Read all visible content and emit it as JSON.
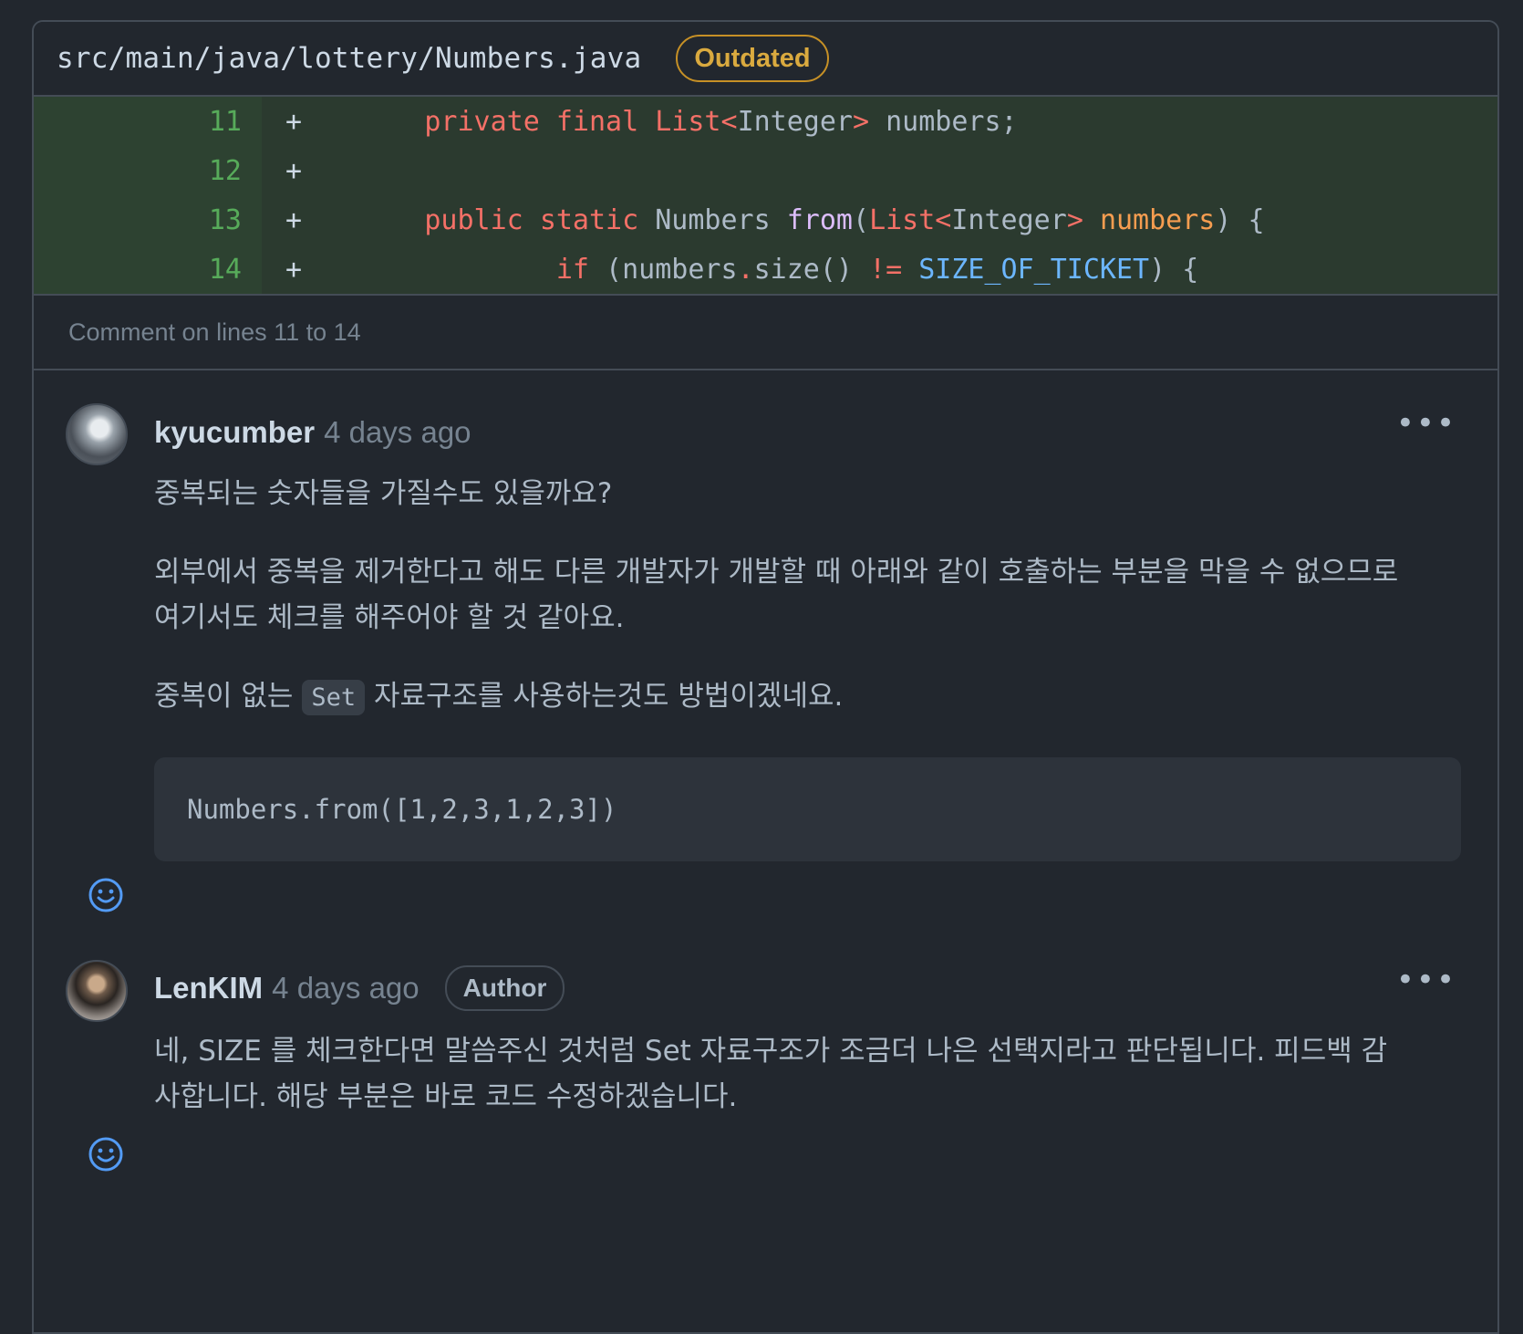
{
  "file": {
    "path": "src/main/java/lottery/Numbers.java",
    "badge": "Outdated"
  },
  "diff": {
    "lines": [
      {
        "num": "11",
        "marker": "+"
      },
      {
        "num": "12",
        "marker": "+"
      },
      {
        "num": "13",
        "marker": "+"
      },
      {
        "num": "14",
        "marker": "+"
      }
    ],
    "code": {
      "l11": {
        "kw1": "private",
        "kw2": "final",
        "type": "List<",
        "cls": "Integer",
        "close": ">",
        "rest": " numbers;"
      },
      "l13": {
        "kw1": "public",
        "kw2": "static",
        "cls": "Numbers",
        "fn": "from",
        "p1": "(",
        "type": "List<",
        "cls2": "Integer",
        "close": ">",
        "param": "numbers",
        "rest": ") {"
      },
      "l14": {
        "kw": "if",
        "p1": " (numbers",
        "dot": ".",
        "call": "size()",
        "op": "!=",
        "const": "SIZE_OF_TICKET",
        "rest": ") {"
      }
    }
  },
  "comment_on": "Comment on lines 11 to 14",
  "comments": [
    {
      "author": "kyucumber",
      "time": "4 days ago",
      "para1": "중복되는 숫자들을 가질수도 있을까요?",
      "para2_line1": "외부에서 중복을 제거한다고 해도 다른 개발자가 개발할 때 아래와 같이 호출하는 부분을 막을 수 없으므로",
      "para2_line2": "여기서도 체크를 해주어야 할 것 같아요.",
      "para3_before": "중복이 없는",
      "para3_code": "Set",
      "para3_after": "자료구조를 사용하는것도 방법이겠네요.",
      "code_block": "Numbers.from([1,2,3,1,2,3])",
      "more": "•••"
    },
    {
      "author": "LenKIM",
      "time": "4 days ago",
      "badge": "Author",
      "line1": "네, SIZE 를 체크한다면 말씀주신 것처럼 Set 자료구조가 조금더 나은 선택지라고 판단됩니다. 피드백 감",
      "line2": "사합니다. 해당 부분은 바로 코드 수정하겠습니다.",
      "more": "•••"
    }
  ]
}
